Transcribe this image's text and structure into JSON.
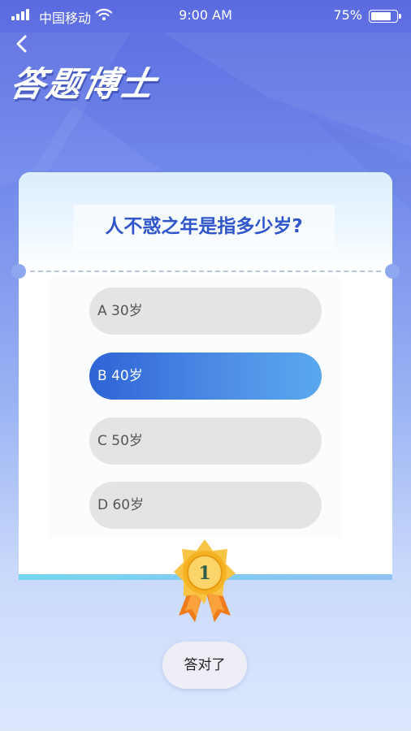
{
  "status_bar": {
    "carrier": "中国移动",
    "time": "9:00 AM",
    "battery_percent": "75%",
    "battery_level": 0.75
  },
  "header": {
    "title": "答题博士"
  },
  "quiz": {
    "question": "人不惑之年是指多少岁?",
    "options": [
      {
        "label": "A 30岁",
        "selected": false
      },
      {
        "label": "B 40岁",
        "selected": true
      },
      {
        "label": "C 50岁",
        "selected": false
      },
      {
        "label": "D 60岁",
        "selected": false
      }
    ]
  },
  "medal": {
    "number": "1"
  },
  "result": {
    "label": "答对了"
  },
  "colors": {
    "accent_blue": "#2e63d6",
    "question_text": "#2f55c9",
    "medal_gold": "#f5b324",
    "ribbon_orange": "#f07b1a"
  }
}
